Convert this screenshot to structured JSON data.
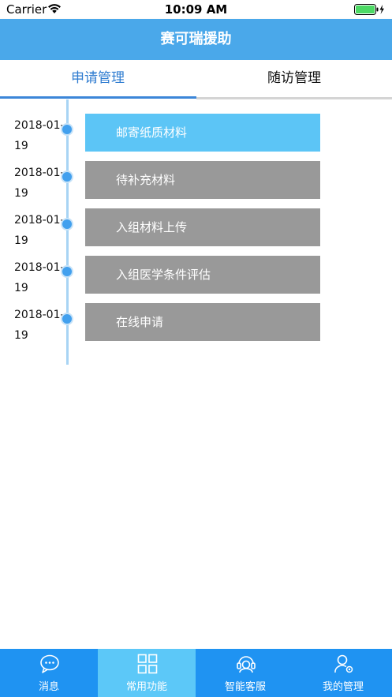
{
  "status_bar": {
    "carrier": "Carrier",
    "time": "10:09 AM"
  },
  "nav": {
    "title": "赛可瑞援助"
  },
  "tabs": [
    {
      "label": "申请管理",
      "active": true
    },
    {
      "label": "随访管理",
      "active": false
    }
  ],
  "timeline": [
    {
      "date": "2018-01-19",
      "date_line1": "2018-01-",
      "date_line2": "19",
      "label": "邮寄纸质材料",
      "active": true
    },
    {
      "date": "2018-01-19",
      "date_line1": "2018-01-",
      "date_line2": "19",
      "label": "待补充材料",
      "active": false
    },
    {
      "date": "2018-01-19",
      "date_line1": "2018-01-",
      "date_line2": "19",
      "label": "入组材料上传",
      "active": false
    },
    {
      "date": "2018-01-19",
      "date_line1": "2018-01-",
      "date_line2": "19",
      "label": "入组医学条件评估",
      "active": false
    },
    {
      "date": "2018-01-19",
      "date_line1": "2018-01-",
      "date_line2": "19",
      "label": "在线申请",
      "active": false
    }
  ],
  "tab_bar": [
    {
      "label": "消息",
      "icon": "chat-bubble-icon",
      "selected": false
    },
    {
      "label": "常用功能",
      "icon": "grid-icon",
      "selected": true
    },
    {
      "label": "智能客服",
      "icon": "headset-icon",
      "selected": false
    },
    {
      "label": "我的管理",
      "icon": "user-gear-icon",
      "selected": false
    }
  ],
  "colors": {
    "nav": "#4aa8ea",
    "active_tab": "#2f7cd0",
    "timeline_active": "#5cc5f6",
    "timeline_inactive": "#999999",
    "tab_bar": "#1f93f2",
    "tab_bar_selected": "#5cc8f8"
  }
}
